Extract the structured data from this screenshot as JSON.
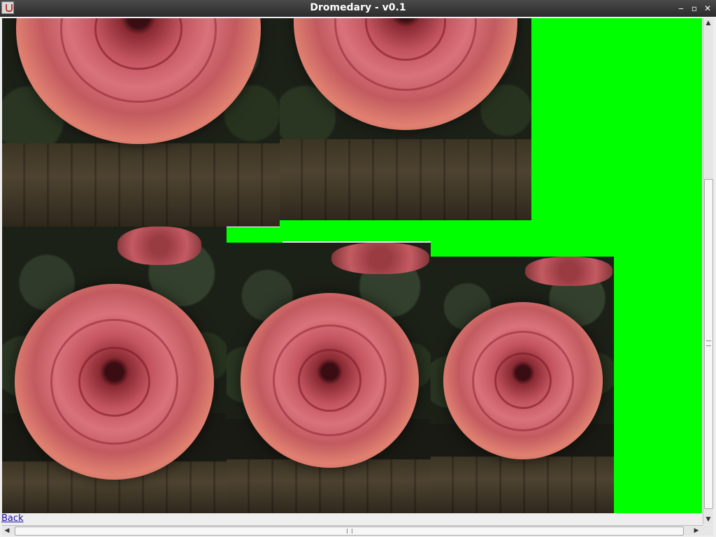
{
  "window": {
    "title": "Dromedary - v0.1",
    "controls": {
      "minimize": "‒",
      "maximize": "▫",
      "close": "✕"
    }
  },
  "canvas": {
    "background_color": "#00ff00",
    "tiles": [
      {
        "name": "rose-tile-1",
        "subject": "pink ranunculus on wood"
      },
      {
        "name": "rose-tile-2",
        "subject": "pink ranunculus on wood"
      },
      {
        "name": "rose-tile-3",
        "subject": "pink ranunculus with leaves"
      },
      {
        "name": "rose-tile-4",
        "subject": "pink ranunculus with leaves"
      },
      {
        "name": "rose-tile-5",
        "subject": "pink ranunculus with leaves"
      }
    ]
  },
  "footer": {
    "back_label": "Back"
  },
  "scrollbars": {
    "vertical": {
      "up": "▲",
      "down": "▼"
    },
    "horizontal": {
      "left": "◀",
      "right": "▶"
    }
  }
}
